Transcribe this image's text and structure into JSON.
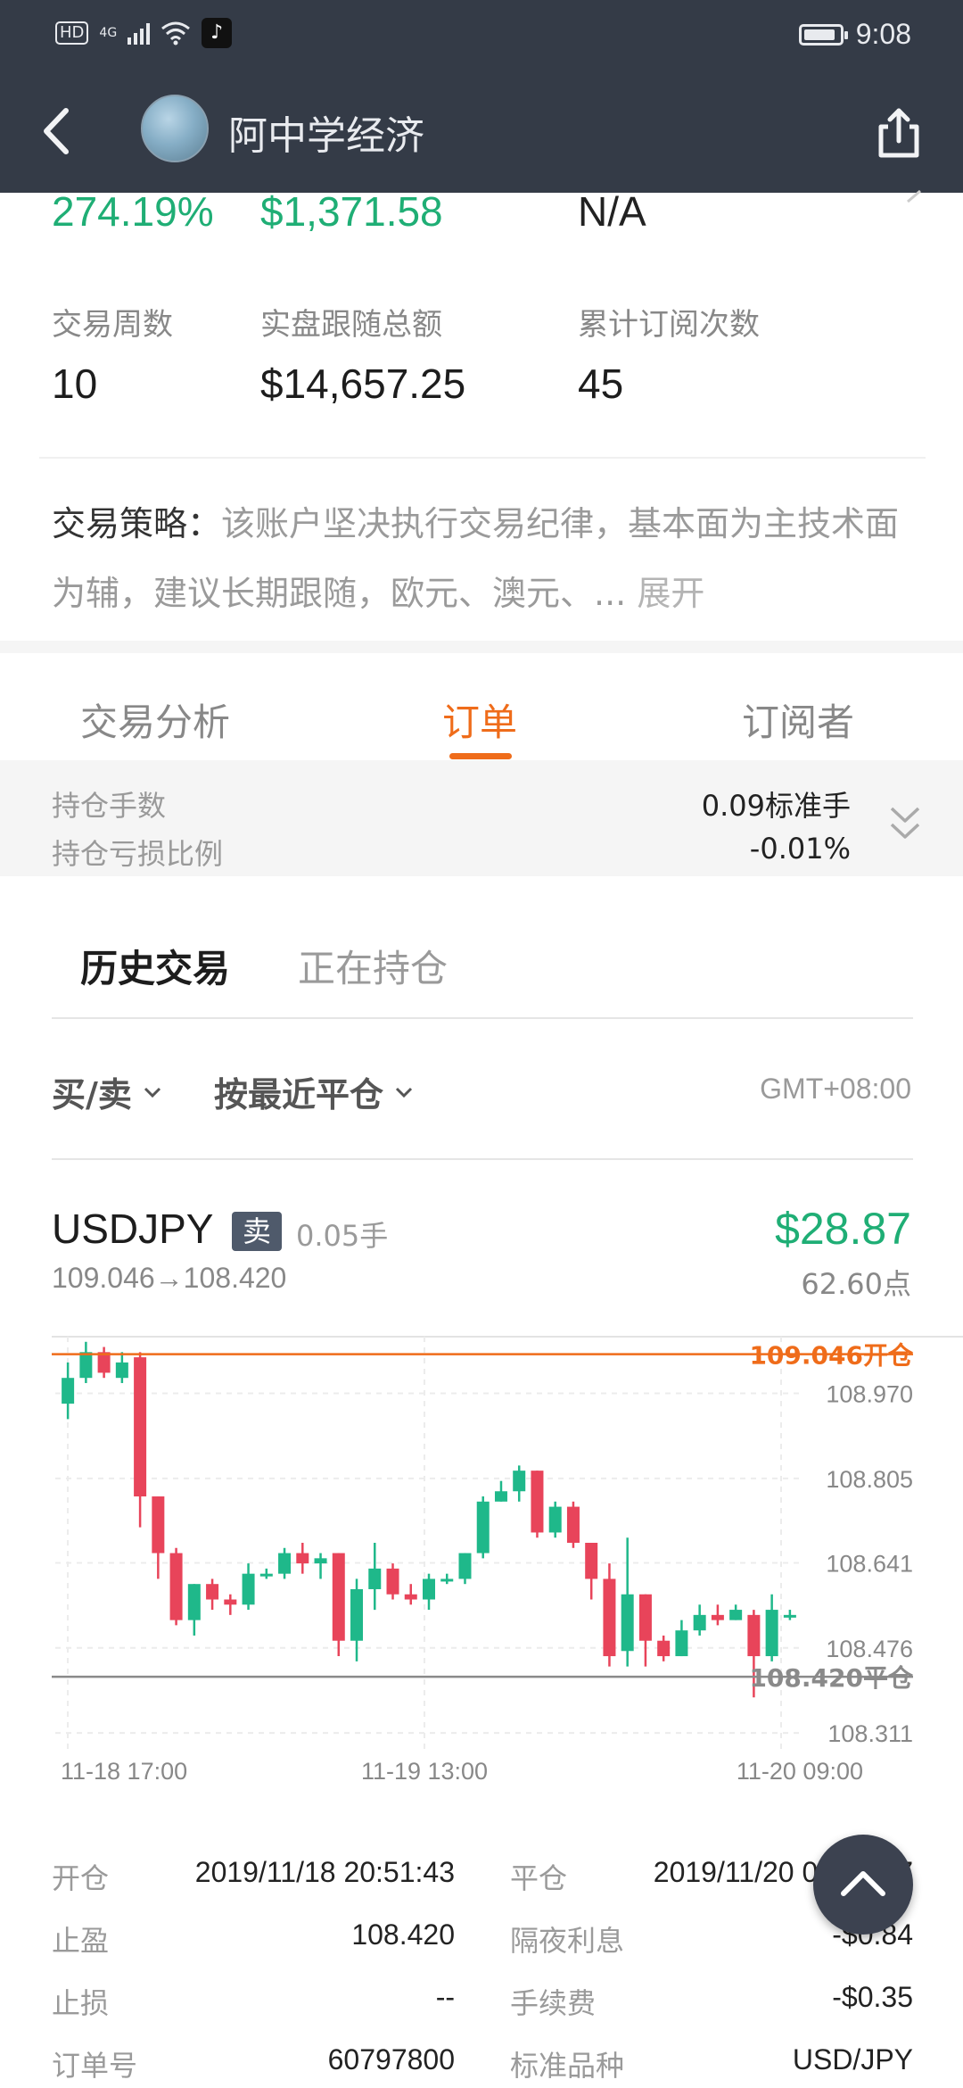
{
  "status_bar": {
    "hd": "HD",
    "signal": "4G",
    "time": "9:08"
  },
  "header": {
    "title": "阿中学经济"
  },
  "stats_top": {
    "return_pct": "274.19%",
    "profit": "$1,371.58",
    "third": "N/A"
  },
  "stats": [
    {
      "label": "交易周数",
      "value": "10"
    },
    {
      "label": "实盘跟随总额",
      "value": "$14,657.25"
    },
    {
      "label": "累计订阅次数",
      "value": "45"
    }
  ],
  "strategy": {
    "label": "交易策略：",
    "text": "该账户坚决执行交易纪律，基本面为主技术面为辅，建议长期跟随，欧元、澳元、...",
    "expand": "展开"
  },
  "tabs": [
    {
      "label": "交易分析",
      "active": false
    },
    {
      "label": "订单",
      "active": true
    },
    {
      "label": "订阅者",
      "active": false
    }
  ],
  "position": {
    "lots_label": "持仓手数",
    "lots_value": "0.09标准手",
    "pnl_label": "持仓亏损比例",
    "pnl_value": "-0.01%"
  },
  "sub_tabs": {
    "history": "历史交易",
    "open": "正在持仓"
  },
  "filters": {
    "side": "买/卖",
    "sort": "按最近平仓",
    "timezone": "GMT+08:00"
  },
  "order": {
    "symbol": "USDJPY",
    "side": "卖",
    "lots": "0.05手",
    "price_from": "109.046",
    "price_to": "108.420",
    "profit": "$28.87",
    "points": "62.60点"
  },
  "chart_data": {
    "type": "candlestick",
    "y_ticks": [
      "108.970",
      "108.805",
      "108.641",
      "108.476",
      "108.311"
    ],
    "x_ticks": [
      "11-18 17:00",
      "11-19 13:00",
      "11-20 09:00"
    ],
    "ylim": [
      108.28,
      109.08
    ],
    "open_line": {
      "value": 109.046,
      "label": "109.046开仓"
    },
    "close_line": {
      "value": 108.42,
      "label": "108.420平仓"
    },
    "candles": [
      [
        108.95,
        109.0,
        109.03,
        108.92
      ],
      [
        109.0,
        109.05,
        109.07,
        108.99
      ],
      [
        109.05,
        109.01,
        109.06,
        109.0
      ],
      [
        109.0,
        109.03,
        109.05,
        108.99
      ],
      [
        109.04,
        108.77,
        109.05,
        108.71
      ],
      [
        108.77,
        108.66,
        108.77,
        108.61
      ],
      [
        108.66,
        108.53,
        108.67,
        108.52
      ],
      [
        108.53,
        108.6,
        108.6,
        108.5
      ],
      [
        108.6,
        108.57,
        108.61,
        108.55
      ],
      [
        108.57,
        108.56,
        108.58,
        108.54
      ],
      [
        108.56,
        108.62,
        108.64,
        108.55
      ],
      [
        108.62,
        108.62,
        108.63,
        108.61
      ],
      [
        108.62,
        108.66,
        108.67,
        108.61
      ],
      [
        108.66,
        108.64,
        108.68,
        108.62
      ],
      [
        108.64,
        108.65,
        108.66,
        108.61
      ],
      [
        108.66,
        108.49,
        108.66,
        108.46
      ],
      [
        108.49,
        108.59,
        108.61,
        108.45
      ],
      [
        108.59,
        108.63,
        108.68,
        108.55
      ],
      [
        108.63,
        108.58,
        108.64,
        108.57
      ],
      [
        108.58,
        108.57,
        108.6,
        108.56
      ],
      [
        108.57,
        108.61,
        108.62,
        108.55
      ],
      [
        108.61,
        108.61,
        108.62,
        108.6
      ],
      [
        108.61,
        108.66,
        108.66,
        108.6
      ],
      [
        108.66,
        108.76,
        108.77,
        108.65
      ],
      [
        108.76,
        108.78,
        108.8,
        108.76
      ],
      [
        108.78,
        108.82,
        108.83,
        108.76
      ],
      [
        108.82,
        108.7,
        108.82,
        108.69
      ],
      [
        108.7,
        108.75,
        108.76,
        108.69
      ],
      [
        108.75,
        108.68,
        108.76,
        108.67
      ],
      [
        108.68,
        108.61,
        108.68,
        108.57
      ],
      [
        108.61,
        108.46,
        108.64,
        108.44
      ],
      [
        108.47,
        108.58,
        108.69,
        108.44
      ],
      [
        108.58,
        108.49,
        108.58,
        108.44
      ],
      [
        108.49,
        108.46,
        108.5,
        108.45
      ],
      [
        108.46,
        108.51,
        108.53,
        108.46
      ],
      [
        108.51,
        108.54,
        108.56,
        108.5
      ],
      [
        108.54,
        108.53,
        108.56,
        108.52
      ],
      [
        108.53,
        108.55,
        108.56,
        108.53
      ],
      [
        108.54,
        108.46,
        108.55,
        108.38
      ],
      [
        108.46,
        108.55,
        108.58,
        108.45
      ],
      [
        108.54,
        108.54,
        108.55,
        108.53
      ]
    ]
  },
  "details": [
    {
      "label": "开仓",
      "value": "2019/11/18 20:51:43"
    },
    {
      "label": "平仓",
      "value": "2019/11/20 07:0?:07"
    },
    {
      "label": "止盈",
      "value": "108.420"
    },
    {
      "label": "隔夜利息",
      "value": "-$0.84"
    },
    {
      "label": "止损",
      "value": "--"
    },
    {
      "label": "手续费",
      "value": "-$0.35"
    },
    {
      "label": "订单号",
      "value": "60797800"
    },
    {
      "label": "标准品种",
      "value": "USD/JPY"
    }
  ],
  "colors": {
    "header_bg": "#343b47",
    "accent": "#ef6c1a",
    "up": "#1fb88a",
    "down": "#e8445a",
    "profit": "#1fae75"
  }
}
